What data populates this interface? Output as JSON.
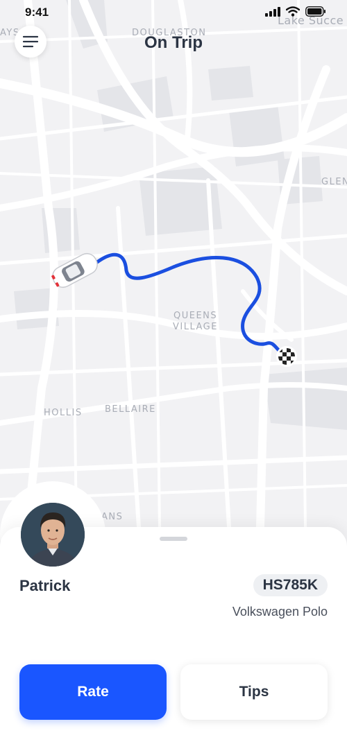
{
  "status_bar": {
    "time": "9:41",
    "icons": [
      "signal-icon",
      "wifi-icon",
      "battery-icon"
    ]
  },
  "header": {
    "title": "On Trip",
    "menu_icon": "menu-icon"
  },
  "map": {
    "labels": {
      "douglaston": "DOUGLASTON",
      "lake_success": "Lake Succe",
      "glen": "GLEN",
      "queens_village_1": "QUEENS",
      "queens_village_2": "VILLAGE",
      "hollis": "HOLLIS",
      "bellaire": "BELLAIRE",
      "ans": "ANS",
      "ays": "AYS"
    },
    "route_color": "#1b4fe0",
    "markers": [
      "car-icon",
      "destination-flag-icon"
    ]
  },
  "driver": {
    "name": "Patrick",
    "plate": "HS785K",
    "car_model": "Volkswagen Polo"
  },
  "actions": {
    "rate_label": "Rate",
    "tips_label": "Tips"
  },
  "colors": {
    "accent": "#1a56ff",
    "title": "#2b3443",
    "map_bg": "#f2f2f4",
    "road": "#ffffff"
  }
}
